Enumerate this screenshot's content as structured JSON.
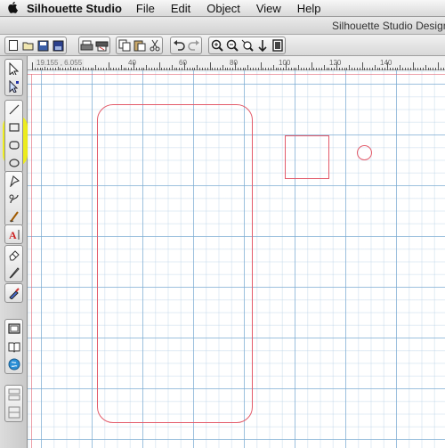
{
  "menubar": {
    "apple_icon": "apple-icon",
    "app_name": "Silhouette Studio",
    "items": [
      "File",
      "Edit",
      "Object",
      "View",
      "Help"
    ]
  },
  "window": {
    "title": "Silhouette Studio Designer Edition"
  },
  "toolbar": {
    "groups": [
      [
        "new-document-icon",
        "open-icon",
        "save-icon",
        "save-to-library-icon"
      ],
      [
        "print-icon",
        "send-to-cutter-icon"
      ],
      [
        "copy-icon",
        "paste-icon",
        "cut-icon"
      ],
      [
        "undo-icon",
        "redo-icon"
      ],
      [
        "zoom-in-icon",
        "zoom-out-icon",
        "zoom-selection-icon",
        "pan-icon",
        "fit-to-page-icon"
      ]
    ]
  },
  "ruler": {
    "cursor_coords": "19.155 , 6.055",
    "ticks": [
      "40",
      "60",
      "80",
      "100",
      "120",
      "140"
    ]
  },
  "left_tools": {
    "groups": [
      [
        "select-tool-icon",
        "edit-points-tool-icon"
      ],
      [
        "line-tool-icon",
        "rectangle-tool-icon",
        "rounded-rectangle-tool-icon",
        "ellipse-tool-icon"
      ],
      [
        "polygon-tool-icon",
        "curve-tool-icon",
        "freehand-tool-icon"
      ],
      [
        "text-tool-icon"
      ],
      [
        "eraser-tool-icon",
        "knife-tool-icon"
      ],
      [
        "color-picker-tool-icon"
      ],
      [
        "page-setup-icon",
        "library-icon",
        "online-store-icon"
      ],
      [
        "panel-toggle-icon"
      ]
    ],
    "highlight_color": "#f2f200"
  },
  "canvas": {
    "grid_color": "#78aad2",
    "shape_color": "#e35b6a",
    "shapes": [
      "rounded-rectangle-shape",
      "square-shape",
      "circle-shape"
    ]
  }
}
